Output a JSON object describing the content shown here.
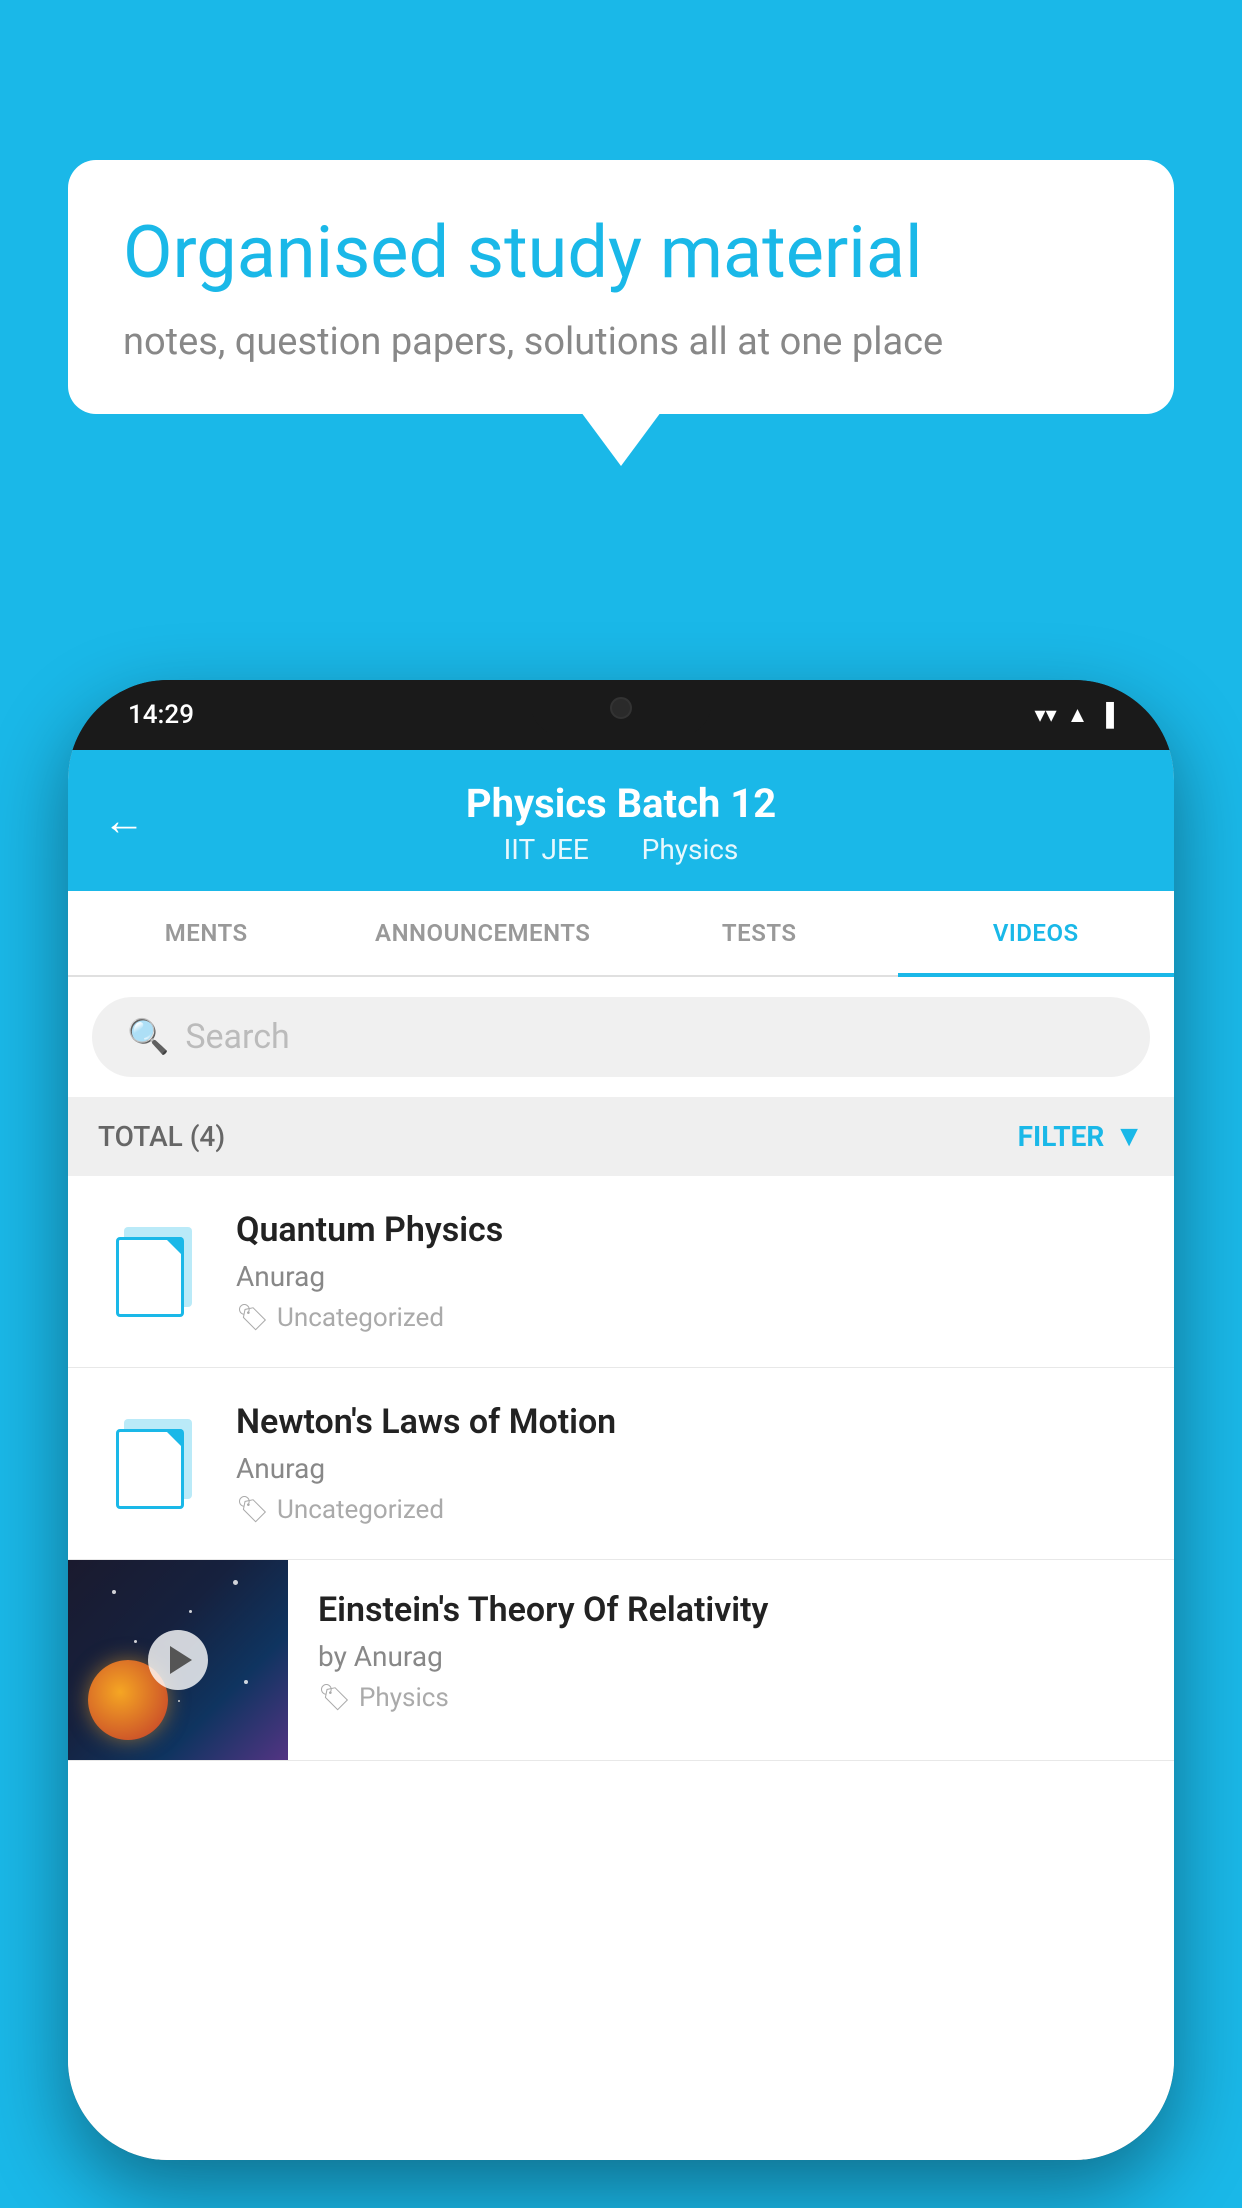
{
  "background_color": "#1ab8e8",
  "speech_bubble": {
    "title": "Organised study material",
    "subtitle": "notes, question papers, solutions all at one place"
  },
  "status_bar": {
    "time": "14:29",
    "icons": [
      "wifi",
      "signal",
      "battery"
    ]
  },
  "app_header": {
    "title": "Physics Batch 12",
    "subtitle_left": "IIT JEE",
    "subtitle_right": "Physics"
  },
  "tabs": [
    {
      "label": "MENTS",
      "active": false
    },
    {
      "label": "ANNOUNCEMENTS",
      "active": false
    },
    {
      "label": "TESTS",
      "active": false
    },
    {
      "label": "VIDEOS",
      "active": true
    }
  ],
  "search": {
    "placeholder": "Search"
  },
  "filter": {
    "total_label": "TOTAL (4)",
    "filter_label": "FILTER"
  },
  "videos": [
    {
      "id": 1,
      "title": "Quantum Physics",
      "author": "Anurag",
      "tag": "Uncategorized",
      "has_thumbnail": false
    },
    {
      "id": 2,
      "title": "Newton's Laws of Motion",
      "author": "Anurag",
      "tag": "Uncategorized",
      "has_thumbnail": false
    },
    {
      "id": 3,
      "title": "Einstein's Theory Of Relativity",
      "author": "by Anurag",
      "tag": "Physics",
      "has_thumbnail": true
    }
  ]
}
